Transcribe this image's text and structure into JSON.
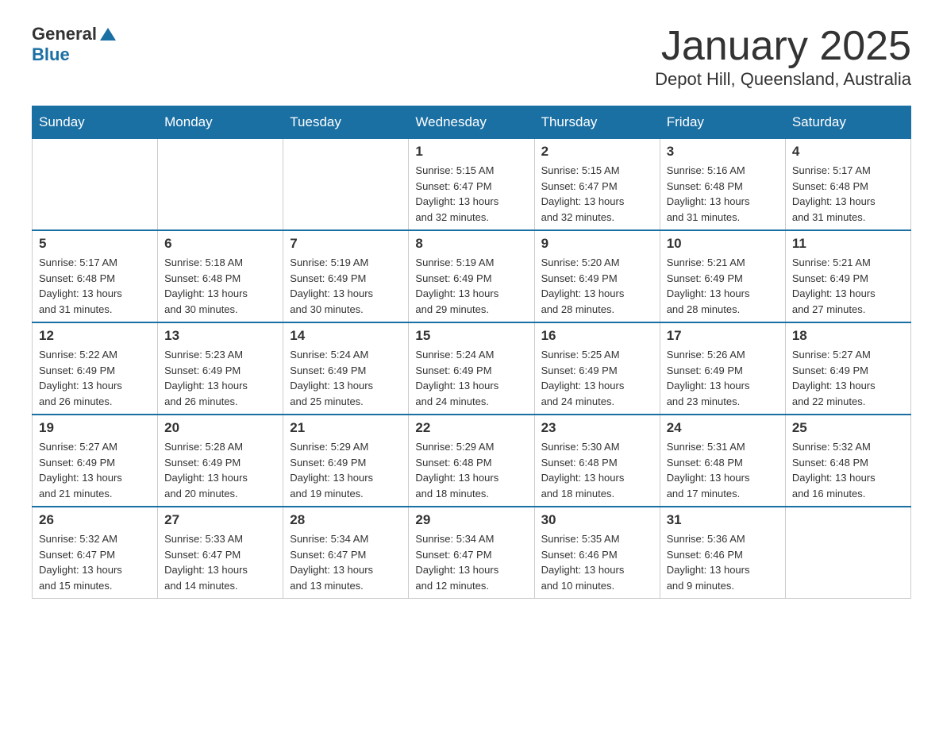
{
  "header": {
    "logo_general": "General",
    "logo_blue": "Blue",
    "month_title": "January 2025",
    "location": "Depot Hill, Queensland, Australia"
  },
  "days_of_week": [
    "Sunday",
    "Monday",
    "Tuesday",
    "Wednesday",
    "Thursday",
    "Friday",
    "Saturday"
  ],
  "weeks": [
    [
      {
        "day": "",
        "info": ""
      },
      {
        "day": "",
        "info": ""
      },
      {
        "day": "",
        "info": ""
      },
      {
        "day": "1",
        "info": "Sunrise: 5:15 AM\nSunset: 6:47 PM\nDaylight: 13 hours\nand 32 minutes."
      },
      {
        "day": "2",
        "info": "Sunrise: 5:15 AM\nSunset: 6:47 PM\nDaylight: 13 hours\nand 32 minutes."
      },
      {
        "day": "3",
        "info": "Sunrise: 5:16 AM\nSunset: 6:48 PM\nDaylight: 13 hours\nand 31 minutes."
      },
      {
        "day": "4",
        "info": "Sunrise: 5:17 AM\nSunset: 6:48 PM\nDaylight: 13 hours\nand 31 minutes."
      }
    ],
    [
      {
        "day": "5",
        "info": "Sunrise: 5:17 AM\nSunset: 6:48 PM\nDaylight: 13 hours\nand 31 minutes."
      },
      {
        "day": "6",
        "info": "Sunrise: 5:18 AM\nSunset: 6:48 PM\nDaylight: 13 hours\nand 30 minutes."
      },
      {
        "day": "7",
        "info": "Sunrise: 5:19 AM\nSunset: 6:49 PM\nDaylight: 13 hours\nand 30 minutes."
      },
      {
        "day": "8",
        "info": "Sunrise: 5:19 AM\nSunset: 6:49 PM\nDaylight: 13 hours\nand 29 minutes."
      },
      {
        "day": "9",
        "info": "Sunrise: 5:20 AM\nSunset: 6:49 PM\nDaylight: 13 hours\nand 28 minutes."
      },
      {
        "day": "10",
        "info": "Sunrise: 5:21 AM\nSunset: 6:49 PM\nDaylight: 13 hours\nand 28 minutes."
      },
      {
        "day": "11",
        "info": "Sunrise: 5:21 AM\nSunset: 6:49 PM\nDaylight: 13 hours\nand 27 minutes."
      }
    ],
    [
      {
        "day": "12",
        "info": "Sunrise: 5:22 AM\nSunset: 6:49 PM\nDaylight: 13 hours\nand 26 minutes."
      },
      {
        "day": "13",
        "info": "Sunrise: 5:23 AM\nSunset: 6:49 PM\nDaylight: 13 hours\nand 26 minutes."
      },
      {
        "day": "14",
        "info": "Sunrise: 5:24 AM\nSunset: 6:49 PM\nDaylight: 13 hours\nand 25 minutes."
      },
      {
        "day": "15",
        "info": "Sunrise: 5:24 AM\nSunset: 6:49 PM\nDaylight: 13 hours\nand 24 minutes."
      },
      {
        "day": "16",
        "info": "Sunrise: 5:25 AM\nSunset: 6:49 PM\nDaylight: 13 hours\nand 24 minutes."
      },
      {
        "day": "17",
        "info": "Sunrise: 5:26 AM\nSunset: 6:49 PM\nDaylight: 13 hours\nand 23 minutes."
      },
      {
        "day": "18",
        "info": "Sunrise: 5:27 AM\nSunset: 6:49 PM\nDaylight: 13 hours\nand 22 minutes."
      }
    ],
    [
      {
        "day": "19",
        "info": "Sunrise: 5:27 AM\nSunset: 6:49 PM\nDaylight: 13 hours\nand 21 minutes."
      },
      {
        "day": "20",
        "info": "Sunrise: 5:28 AM\nSunset: 6:49 PM\nDaylight: 13 hours\nand 20 minutes."
      },
      {
        "day": "21",
        "info": "Sunrise: 5:29 AM\nSunset: 6:49 PM\nDaylight: 13 hours\nand 19 minutes."
      },
      {
        "day": "22",
        "info": "Sunrise: 5:29 AM\nSunset: 6:48 PM\nDaylight: 13 hours\nand 18 minutes."
      },
      {
        "day": "23",
        "info": "Sunrise: 5:30 AM\nSunset: 6:48 PM\nDaylight: 13 hours\nand 18 minutes."
      },
      {
        "day": "24",
        "info": "Sunrise: 5:31 AM\nSunset: 6:48 PM\nDaylight: 13 hours\nand 17 minutes."
      },
      {
        "day": "25",
        "info": "Sunrise: 5:32 AM\nSunset: 6:48 PM\nDaylight: 13 hours\nand 16 minutes."
      }
    ],
    [
      {
        "day": "26",
        "info": "Sunrise: 5:32 AM\nSunset: 6:47 PM\nDaylight: 13 hours\nand 15 minutes."
      },
      {
        "day": "27",
        "info": "Sunrise: 5:33 AM\nSunset: 6:47 PM\nDaylight: 13 hours\nand 14 minutes."
      },
      {
        "day": "28",
        "info": "Sunrise: 5:34 AM\nSunset: 6:47 PM\nDaylight: 13 hours\nand 13 minutes."
      },
      {
        "day": "29",
        "info": "Sunrise: 5:34 AM\nSunset: 6:47 PM\nDaylight: 13 hours\nand 12 minutes."
      },
      {
        "day": "30",
        "info": "Sunrise: 5:35 AM\nSunset: 6:46 PM\nDaylight: 13 hours\nand 10 minutes."
      },
      {
        "day": "31",
        "info": "Sunrise: 5:36 AM\nSunset: 6:46 PM\nDaylight: 13 hours\nand 9 minutes."
      },
      {
        "day": "",
        "info": ""
      }
    ]
  ]
}
